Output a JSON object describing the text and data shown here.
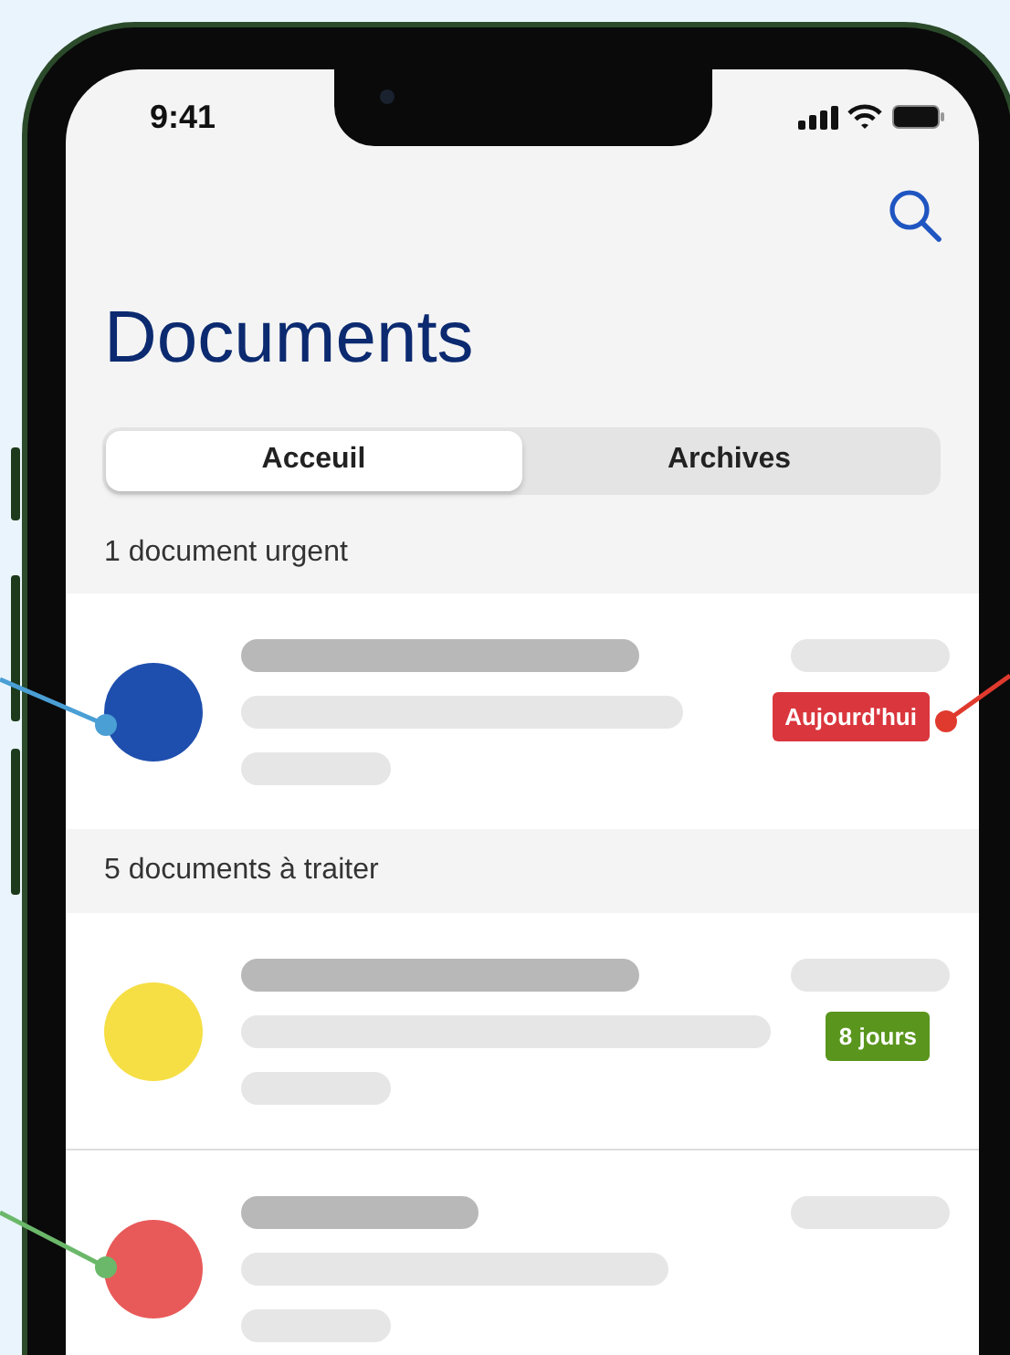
{
  "status_bar": {
    "time": "9:41"
  },
  "title": "Documents",
  "tabs": [
    {
      "label": "Acceuil",
      "selected": true
    },
    {
      "label": "Archives",
      "selected": false
    }
  ],
  "sections": [
    {
      "heading": "1 document urgent",
      "items": [
        {
          "color": "#1f4fae",
          "badge": {
            "text": "Aujourd'hui",
            "color": "#d9363e"
          }
        }
      ]
    },
    {
      "heading": "5 documents à traiter",
      "items": [
        {
          "color": "#f6de45",
          "badge": {
            "text": "8 jours",
            "color": "#5a961e"
          }
        },
        {
          "color": "#e85a59"
        }
      ]
    }
  ]
}
